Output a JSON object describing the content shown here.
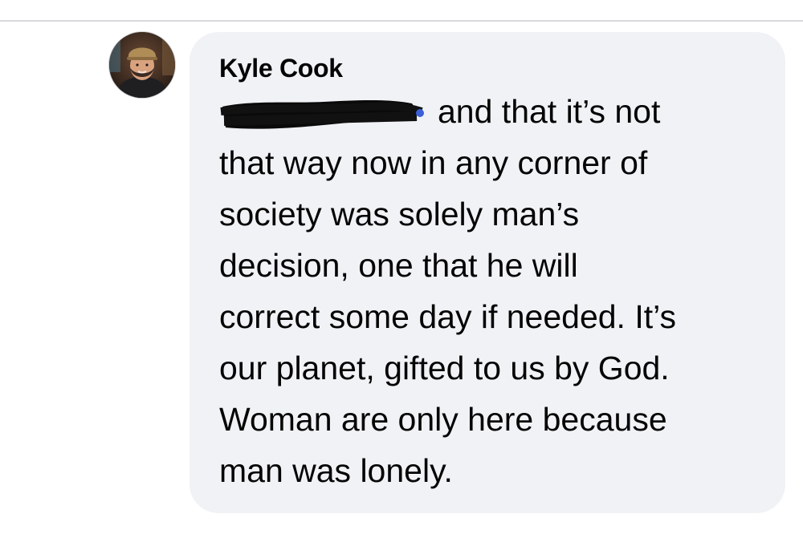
{
  "comment": {
    "author": "Kyle Cook",
    "first_line_visible": "and that it’s not",
    "lines": [
      "that way now in any corner of",
      "society was solely man’s",
      "decision, one that he will",
      "correct some day if needed. It’s",
      "our planet, gifted to us by God.",
      "Woman are only here because",
      "man was lonely."
    ]
  },
  "avatar_icon": "profile-photo",
  "redaction_icon": "scribble-redaction",
  "colors": {
    "bubble_bg": "#f0f2f5",
    "text": "#050505",
    "secondary_text": "#65676b",
    "divider": "#d8d9dc"
  }
}
